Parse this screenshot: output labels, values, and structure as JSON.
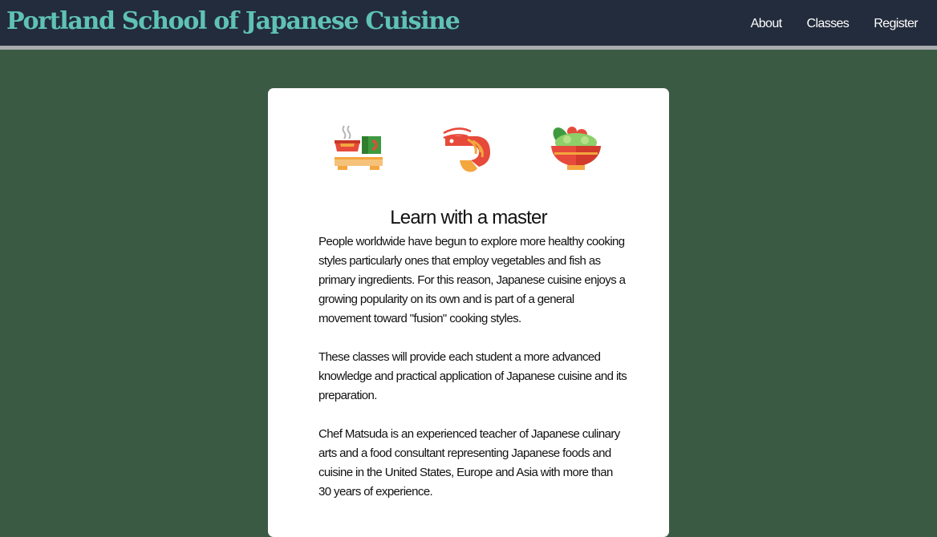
{
  "header": {
    "title": "Portland School of Japanese Cuisine",
    "nav": [
      {
        "label": "About"
      },
      {
        "label": "Classes"
      },
      {
        "label": "Register"
      }
    ]
  },
  "main": {
    "icons": [
      "tea-set-icon",
      "shrimp-icon",
      "salad-bowl-icon"
    ],
    "heading": "Learn with a master",
    "paragraphs": [
      "People worldwide have begun to explore more healthy cooking styles particularly ones that employ vegetables and fish as primary ingredients. For this reason, Japanese cuisine enjoys a growing popularity on its own and is part of a general movement toward \"fusion\" cooking styles.",
      "These classes will provide each student a more advanced knowledge and practical application of Japanese cuisine and its preparation.",
      "Chef Matsuda is an experienced teacher of Japanese culinary arts and a food consultant representing Japanese foods and cuisine in the United States, Europe and Asia with more than 30 years of experience."
    ]
  },
  "colors": {
    "background": "#3b5a44",
    "header_background": "#232c3c",
    "header_border": "#a8abae",
    "title_color": "#5fc2b4",
    "card_background": "#ffffff"
  }
}
